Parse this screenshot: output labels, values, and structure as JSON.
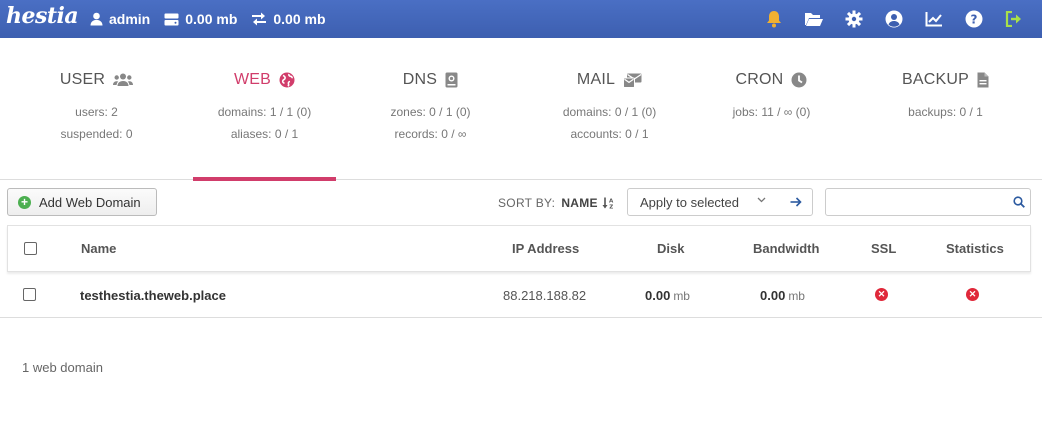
{
  "brand": {
    "logo_text": "hestia"
  },
  "topbar": {
    "user": "admin",
    "disk": "0.00 mb",
    "bandwidth": "0.00 mb",
    "icons": [
      "bell-icon",
      "folder-open-icon",
      "gear-icon",
      "user-circle-icon",
      "chart-line-icon",
      "help-icon",
      "logout-icon"
    ],
    "bell_color": "#f0b030",
    "logout_color": "#a8e04a"
  },
  "tabs": [
    {
      "title": "USER",
      "icon": "users-icon",
      "line1": "users: 2",
      "line2": "suspended: 0",
      "active": false
    },
    {
      "title": "WEB",
      "icon": "globe-icon",
      "line1": "domains: 1 / 1 (0)",
      "line2": "aliases: 0 / 1",
      "active": true
    },
    {
      "title": "DNS",
      "icon": "book-icon",
      "line1": "zones: 0 / 1 (0)",
      "line2": "records: 0 / ∞",
      "active": false
    },
    {
      "title": "MAIL",
      "icon": "mail-icon",
      "line1": "domains: 0 / 1 (0)",
      "line2": "accounts: 0 / 1",
      "active": false
    },
    {
      "title": "CRON",
      "icon": "clock-icon",
      "line1": "jobs: 11 / ∞ (0)",
      "line2": "",
      "active": false
    },
    {
      "title": "BACKUP",
      "icon": "file-icon",
      "line1": "backups: 0 / 1",
      "line2": "",
      "active": false
    }
  ],
  "accent_color": "#d13d6b",
  "toolbar": {
    "add_label": "Add Web Domain",
    "sort_label": "SORT BY:",
    "sort_value": "NAME",
    "bulk_placeholder": "Apply to selected",
    "search_value": ""
  },
  "table": {
    "headers": {
      "name": "Name",
      "ip": "IP Address",
      "disk": "Disk",
      "bandwidth": "Bandwidth",
      "ssl": "SSL",
      "stats": "Statistics"
    },
    "rows": [
      {
        "name": "testhestia.theweb.place",
        "ip": "88.218.188.82",
        "disk": "0.00",
        "disk_unit": "mb",
        "bandwidth": "0.00",
        "bandwidth_unit": "mb",
        "ssl": "disabled",
        "stats": "disabled"
      }
    ]
  },
  "footer": {
    "count_text": "1 web domain"
  }
}
